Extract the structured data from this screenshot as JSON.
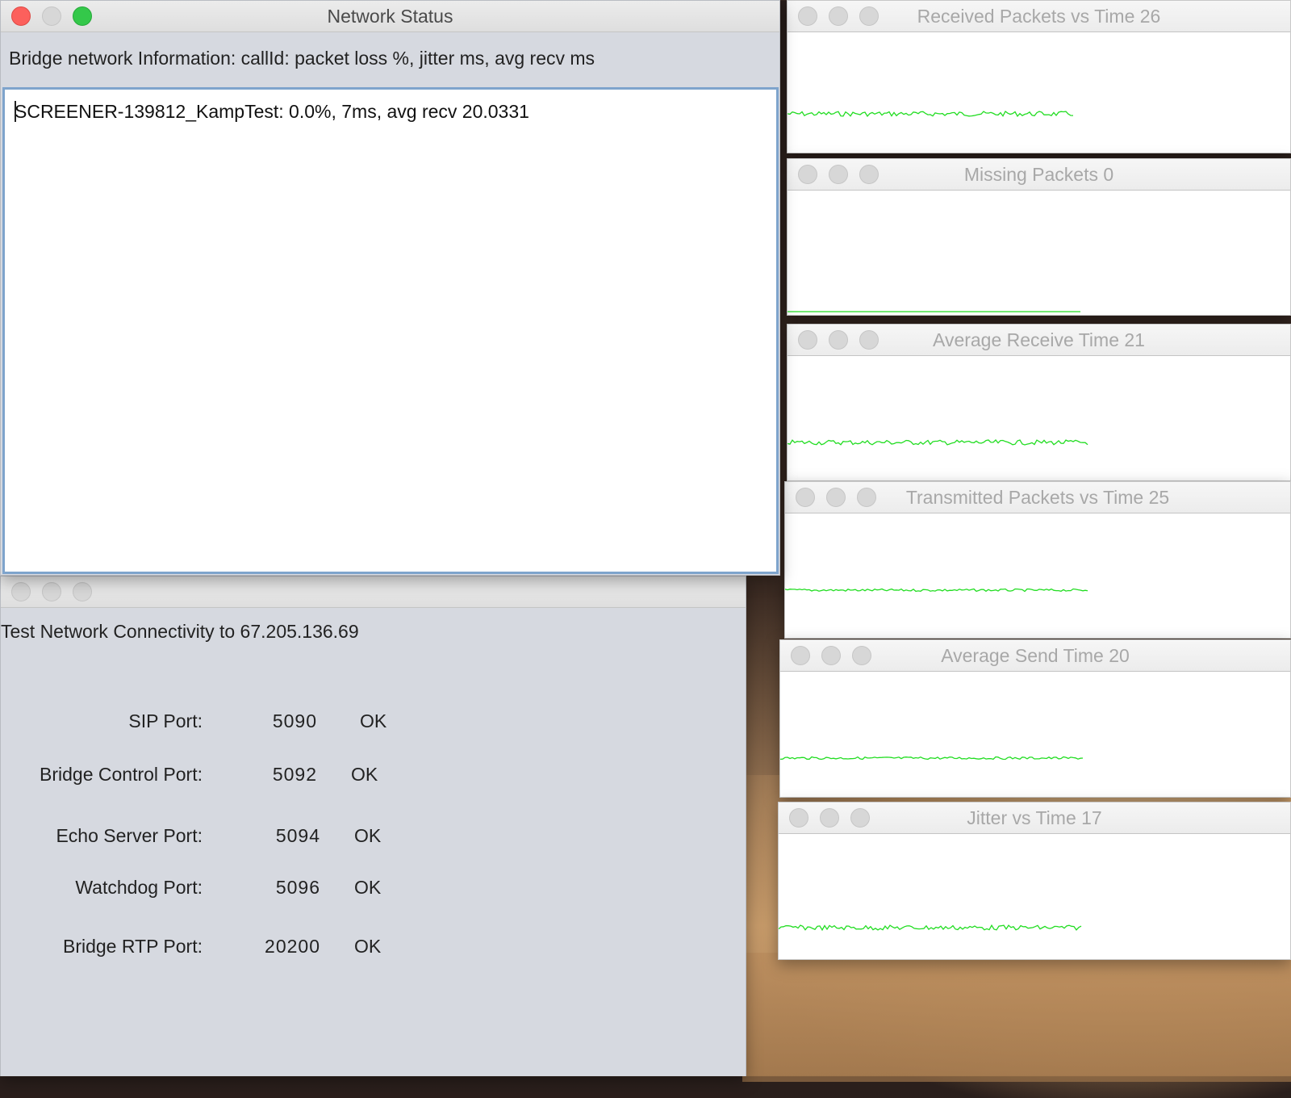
{
  "network_window": {
    "title": "Network Status",
    "header": "Bridge network Information:  callId:  packet loss %,  jitter ms, avg recv ms",
    "status_line": "SCREENER-139812_KampTest: 0.0%, 7ms, avg recv 20.0331"
  },
  "connectivity_window": {
    "title": "Test Network Connectivity to 67.205.136.69",
    "ports": [
      {
        "label": "SIP Port:",
        "port": "5090",
        "status": "OK"
      },
      {
        "label": "Bridge Control Port:",
        "port": "5092",
        "status": "OK"
      },
      {
        "label": "Echo Server Port:",
        "port": "5094",
        "status": "OK"
      },
      {
        "label": "Watchdog Port:",
        "port": "5096",
        "status": "OK"
      },
      {
        "label": "Bridge RTP Port:",
        "port": "20200",
        "status": "OK"
      }
    ]
  },
  "graph_windows": [
    {
      "title": "Received Packets vs Time 26",
      "line_color": "#22dd22"
    },
    {
      "title": "Missing Packets 0",
      "line_color": "#22dd22"
    },
    {
      "title": "Average Receive Time 21",
      "line_color": "#22dd22"
    },
    {
      "title": "Transmitted Packets vs Time 25",
      "line_color": "#22dd22"
    },
    {
      "title": "Average Send Time 20",
      "line_color": "#22dd22"
    },
    {
      "title": "Jitter vs Time 17",
      "line_color": "#22dd22"
    }
  ]
}
